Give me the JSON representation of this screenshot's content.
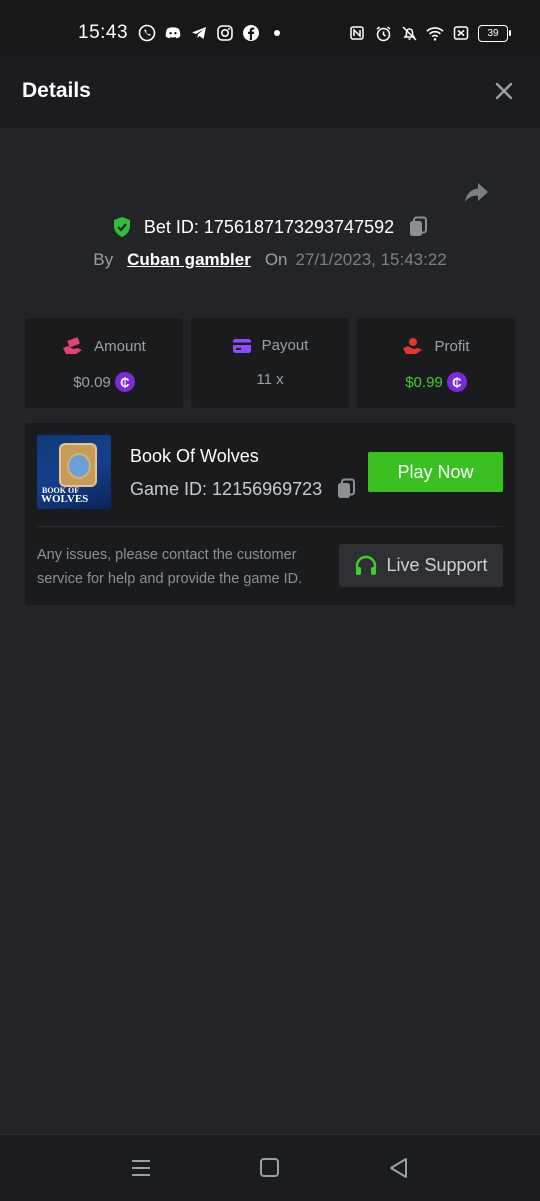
{
  "status_bar": {
    "time": "15:43",
    "app_icons": [
      "whatsapp-icon",
      "discord-icon",
      "telegram-icon",
      "instagram-icon",
      "facebook-icon",
      "dot-icon"
    ],
    "system_icons": [
      "nfc-icon",
      "alarm-icon",
      "mute-icon",
      "wifi-icon",
      "sim-icon"
    ],
    "battery": "39"
  },
  "header": {
    "title": "Details"
  },
  "bet": {
    "id_label": "Bet ID:",
    "id_value": "1756187173293747592",
    "by_label": "By",
    "user": "Cuban gambler",
    "on_label": "On",
    "datetime": "27/1/2023, 15:43:22"
  },
  "stats": [
    {
      "label": "Amount",
      "value": "$0.09",
      "icon": "money-hand-icon",
      "color": "#e63f7a"
    },
    {
      "label": "Payout",
      "value": "11 x",
      "icon": "card-icon",
      "color": "#8b4dff"
    },
    {
      "label": "Profit",
      "value": "$0.99",
      "icon": "profit-hand-icon",
      "color": "#e0382f"
    }
  ],
  "game": {
    "title": "Book Of Wolves",
    "id_label": "Game ID:",
    "id_value": "12156969723",
    "thumb_line1": "BOOK OF",
    "thumb_line2": "WOLVES",
    "play_label": "Play Now"
  },
  "support": {
    "help_text": "Any issues, please contact the customer service for help and provide the game ID.",
    "button_label": "Live Support"
  },
  "colors": {
    "accent_green": "#3ac11f",
    "coin_purple": "#7a2ad9",
    "profit_green": "#3fcf2a"
  }
}
